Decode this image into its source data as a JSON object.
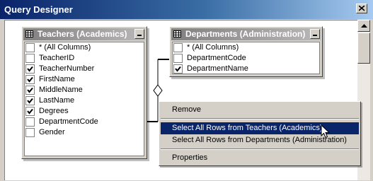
{
  "window": {
    "title": "Query Designer"
  },
  "tables": [
    {
      "title": "Teachers (Academics)",
      "columns": [
        {
          "label": "* (All Columns)",
          "checked": false
        },
        {
          "label": "TeacherID",
          "checked": false
        },
        {
          "label": "TeacherNumber",
          "checked": true
        },
        {
          "label": "FirstName",
          "checked": true
        },
        {
          "label": "MiddleName",
          "checked": true
        },
        {
          "label": "LastName",
          "checked": true
        },
        {
          "label": "Degrees",
          "checked": true
        },
        {
          "label": "DepartmentCode",
          "checked": false
        },
        {
          "label": "Gender",
          "checked": false
        }
      ]
    },
    {
      "title": "Departments (Administration)",
      "columns": [
        {
          "label": "* (All Columns)",
          "checked": false
        },
        {
          "label": "DepartmentCode",
          "checked": false
        },
        {
          "label": "DepartmentName",
          "checked": true
        }
      ]
    }
  ],
  "context_menu": {
    "items": [
      {
        "label": "Remove",
        "highlighted": false
      },
      {
        "label": "Select All Rows from Teachers (Academics)",
        "highlighted": true
      },
      {
        "label": "Select All Rows from Departments (Administration)",
        "highlighted": false
      },
      {
        "label": "Properties",
        "highlighted": false
      }
    ]
  },
  "icons": [
    "close-icon",
    "table-grid-icon",
    "minimize-icon",
    "checkmark-icon",
    "relationship-diamond-icon",
    "mouse-cursor-icon",
    "scroll-up-arrow-icon"
  ],
  "colors": {
    "titlebar": "#0a246a",
    "highlight": "#0a246a",
    "chrome": "#d4d0c8"
  }
}
